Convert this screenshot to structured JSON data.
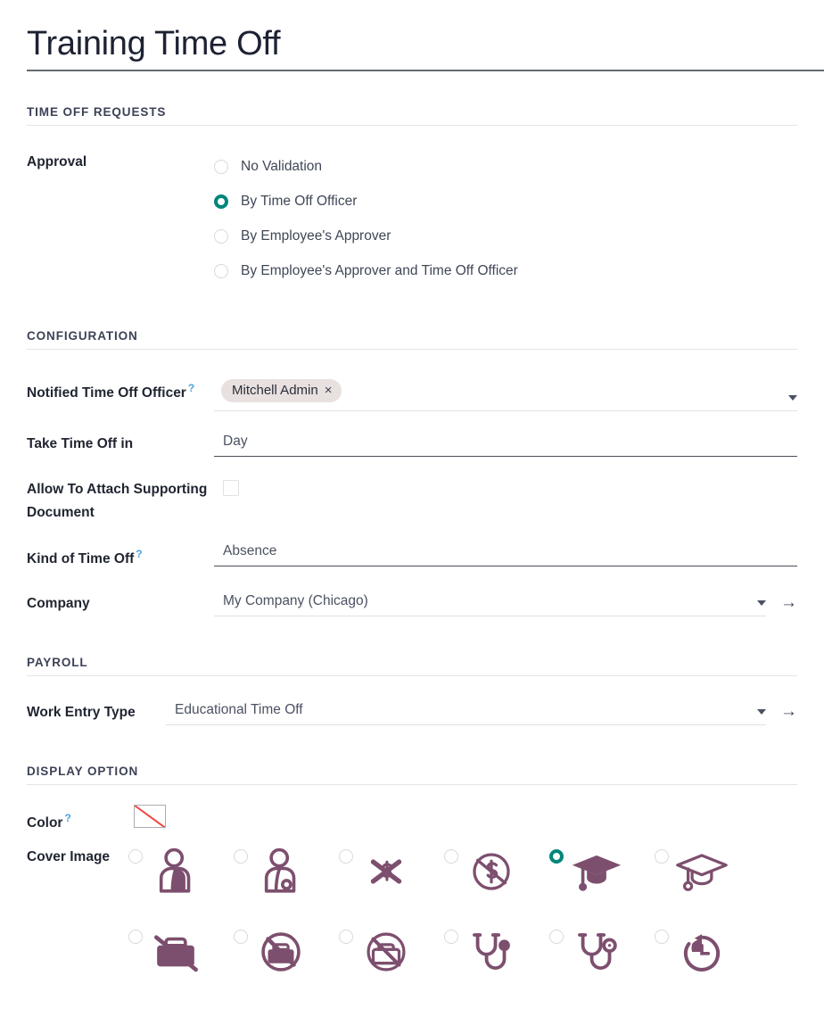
{
  "record": {
    "title": "Training Time Off"
  },
  "sections": {
    "requests": "TIME OFF REQUESTS",
    "configuration": "CONFIGURATION",
    "payroll": "PAYROLL",
    "display_option": "DISPLAY OPTION"
  },
  "approval": {
    "label": "Approval",
    "options": [
      {
        "label": "No Validation",
        "selected": false
      },
      {
        "label": "By Time Off Officer",
        "selected": true
      },
      {
        "label": "By Employee's Approver",
        "selected": false
      },
      {
        "label": "By Employee's Approver and Time Off Officer",
        "selected": false
      }
    ]
  },
  "configuration": {
    "notified_officer": {
      "label": "Notified Time Off Officer",
      "help": "?",
      "tags": [
        {
          "name": "Mitchell Admin",
          "remove": "×"
        }
      ]
    },
    "take_time_off_in": {
      "label": "Take Time Off in",
      "value": "Day"
    },
    "allow_attach": {
      "label": "Allow To Attach Supporting Document",
      "checked": false
    },
    "kind_of_time_off": {
      "label": "Kind of Time Off",
      "help": "?",
      "value": "Absence"
    },
    "company": {
      "label": "Company",
      "value": "My Company (Chicago)",
      "internal_link": "→"
    }
  },
  "payroll": {
    "work_entry_type": {
      "label": "Work Entry Type",
      "value": "Educational Time Off",
      "internal_link": "→"
    }
  },
  "display_option": {
    "color": {
      "label": "Color",
      "help": "?",
      "value": "No color"
    },
    "cover_image": {
      "label": "Cover Image",
      "items": [
        {
          "icon": "person-arm-sling-filled-icon",
          "selected": false
        },
        {
          "icon": "person-arm-sling-outline-icon",
          "selected": false
        },
        {
          "icon": "money-crossed-out-icon",
          "selected": false
        },
        {
          "icon": "no-money-circle-icon",
          "selected": false
        },
        {
          "icon": "graduation-cap-filled-icon",
          "selected": true
        },
        {
          "icon": "graduation-cap-outline-icon",
          "selected": false
        },
        {
          "icon": "briefcase-slash-filled-icon",
          "selected": false
        },
        {
          "icon": "no-briefcase-circle-filled-icon",
          "selected": false
        },
        {
          "icon": "no-briefcase-circle-outline-icon",
          "selected": false
        },
        {
          "icon": "stethoscope-filled-icon",
          "selected": false
        },
        {
          "icon": "stethoscope-outline-icon",
          "selected": false
        },
        {
          "icon": "clock-rotate-back-icon",
          "selected": false
        }
      ]
    }
  },
  "colors": {
    "accent_teal": "#00877a",
    "icon_mauve": "#7d4f6e",
    "title_text": "#1d2233",
    "label_text": "#1f2430",
    "help_blue": "#4aa3df",
    "tag_bg": "#e9e0e0",
    "swatch_slash": "#f0483e"
  }
}
